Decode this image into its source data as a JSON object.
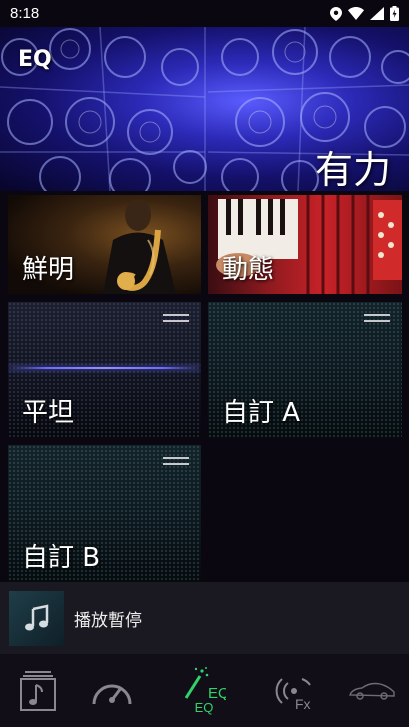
{
  "status_bar": {
    "time": "8:18"
  },
  "hero": {
    "title": "EQ",
    "current_mode": "有力"
  },
  "tiles": {
    "vivid": {
      "label": "鮮明"
    },
    "dynamic": {
      "label": "動態"
    },
    "flat": {
      "label": "平坦"
    },
    "custom_a": {
      "label": "自訂 A"
    },
    "custom_b": {
      "label": "自訂 B"
    }
  },
  "player": {
    "title": "播放暫停"
  },
  "bottom_nav": {
    "items": [
      {
        "icon": "music-library-icon"
      },
      {
        "icon": "speedometer-icon"
      },
      {
        "icon": "eq-wand-icon",
        "label": "EQ",
        "active": true
      },
      {
        "icon": "fx-surround-icon"
      },
      {
        "icon": "car-icon"
      }
    ]
  },
  "colors": {
    "accent_green": "#2fd36a",
    "flat_glow": "#6a6cff",
    "custom_glow": "#2fb6d6"
  }
}
